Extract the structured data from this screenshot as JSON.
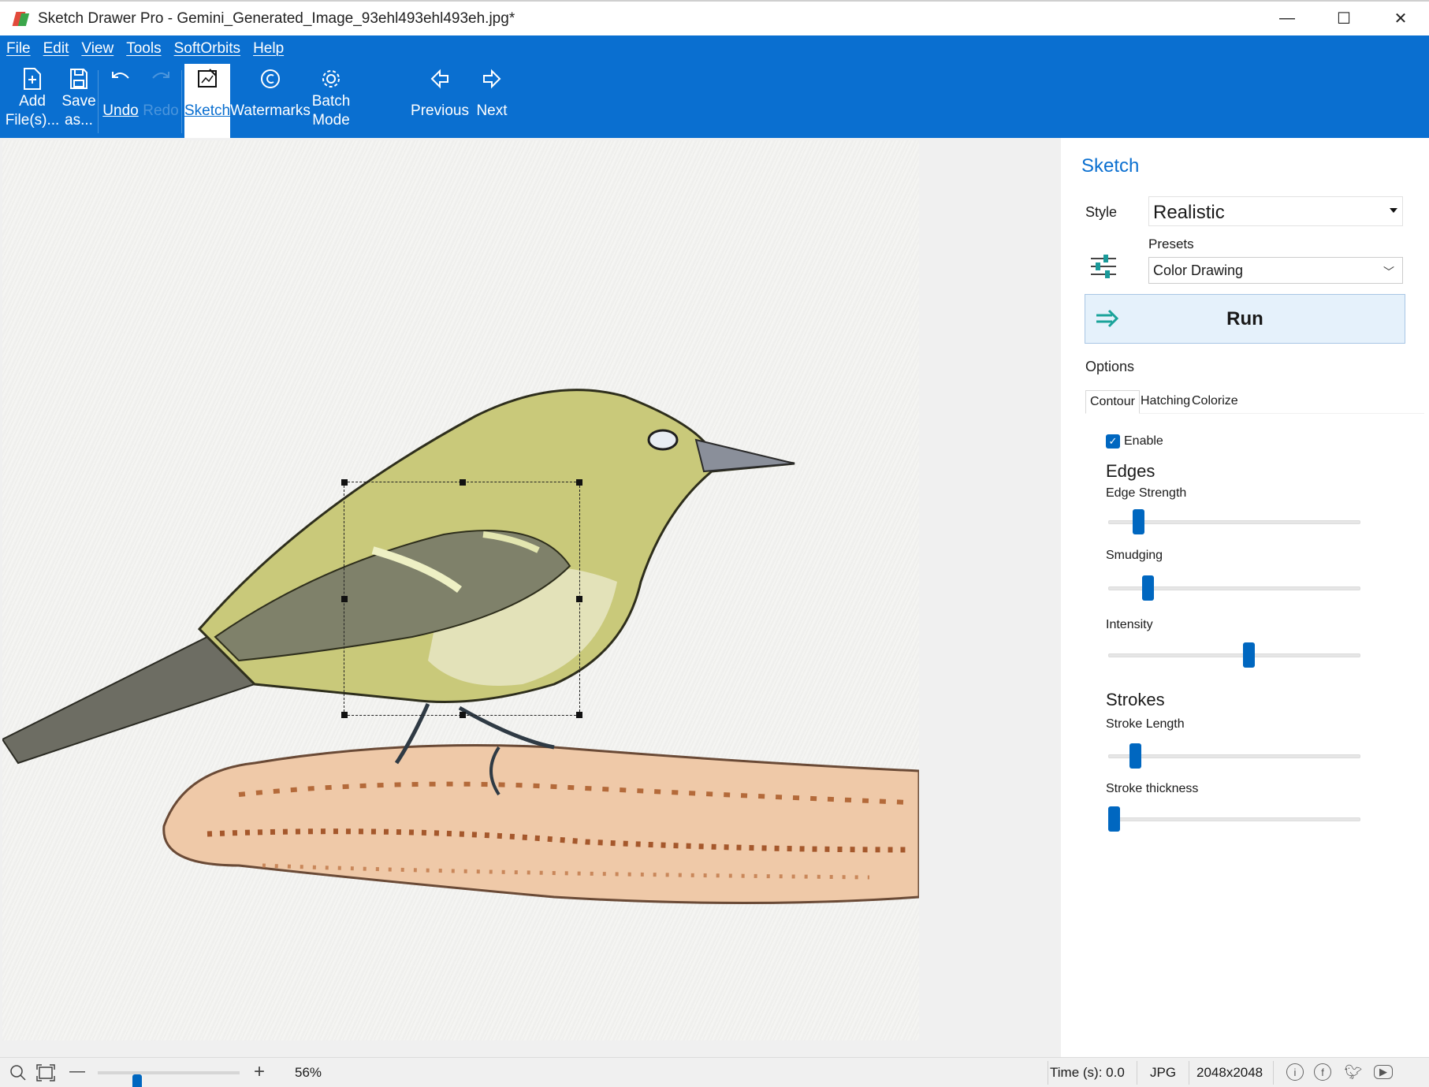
{
  "window": {
    "title": "Sketch Drawer Pro - Gemini_Generated_Image_93ehl493ehl493eh.jpg*",
    "minimize": "—",
    "maximize": "☐",
    "close": "✕"
  },
  "menu": [
    "File",
    "Edit",
    "View",
    "Tools",
    "SoftOrbits",
    "Help"
  ],
  "toolbar": {
    "add_files": [
      "Add",
      "File(s)..."
    ],
    "save_as": [
      "Save",
      "as..."
    ],
    "undo": "Undo",
    "redo": "Redo",
    "sketch": "Sketch",
    "watermarks": "Watermarks",
    "batch_mode": [
      "Batch",
      "Mode"
    ],
    "previous": "Previous",
    "next": "Next"
  },
  "panel": {
    "title": "Sketch",
    "style_label": "Style",
    "style_value": "Realistic",
    "presets_label": "Presets",
    "presets_value": "Color Drawing",
    "run_label": "Run",
    "options_label": "Options",
    "tabs": [
      "Contour",
      "Hatching",
      "Colorize"
    ],
    "active_tab": "Contour",
    "enable_label": "Enable",
    "enable_checked": true,
    "edges_title": "Edges",
    "edge_strength_label": "Edge Strength",
    "edge_strength_level": 0.1,
    "smudging_label": "Smudging",
    "smudging_level": 0.14,
    "intensity_label": "Intensity",
    "intensity_level": 0.56,
    "strokes_title": "Strokes",
    "stroke_length_label": "Stroke Length",
    "stroke_length_level": 0.09,
    "stroke_thickness_label": "Stroke thickness",
    "stroke_thickness_level": 0.0
  },
  "status": {
    "zoom_level": "56%",
    "zoom_fraction": 0.26,
    "time": "Time (s): 0.0",
    "format": "JPG",
    "dimensions": "2048x2048"
  },
  "colors": {
    "accent": "#0a6fd0",
    "slider_thumb": "#0067c0",
    "run_bg": "#e5f1fb"
  }
}
